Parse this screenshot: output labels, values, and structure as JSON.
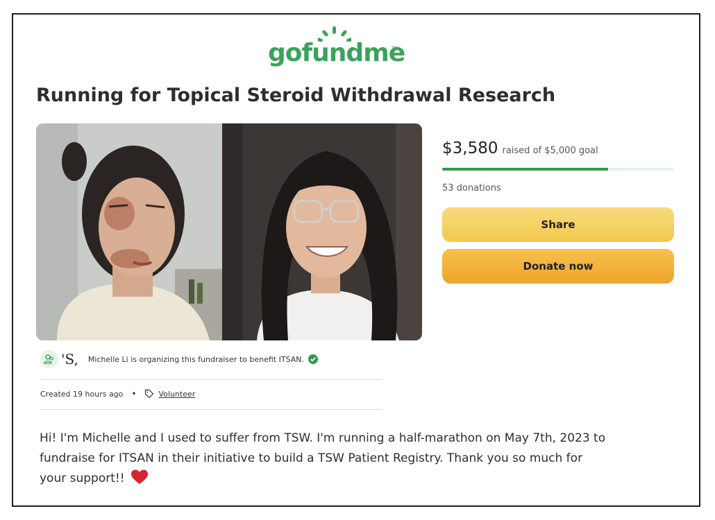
{
  "brand": {
    "logo_text": "gofundme",
    "trademark": "TM"
  },
  "campaign": {
    "title": "Running for Topical Steroid Withdrawal Research",
    "organizer_badge": "'S,",
    "organizer_text": "Michelle Li is organizing this fundraiser to benefit ITSAN.",
    "created": "Created 19 hours ago",
    "separator": "•",
    "category": "Volunteer",
    "story": "Hi! I'm Michelle and I used to suffer from TSW. I'm running a half-marathon on May 7th, 2023 to fundraise for ITSAN in their initiative to build a TSW Patient Registry. Thank you so much for your support!!"
  },
  "donation_box": {
    "amount_raised": "$3,580",
    "goal_label": "raised of $5,000 goal",
    "progress_fraction": 0.716,
    "donations_count": "53 donations",
    "share_label": "Share",
    "donate_label": "Donate now"
  },
  "colors": {
    "brand_green": "#3aa35b",
    "progress_fill": "#2d9b52",
    "share_button": "#f5d266",
    "donate_button": "#f1ae38",
    "heart": "#d62631"
  }
}
